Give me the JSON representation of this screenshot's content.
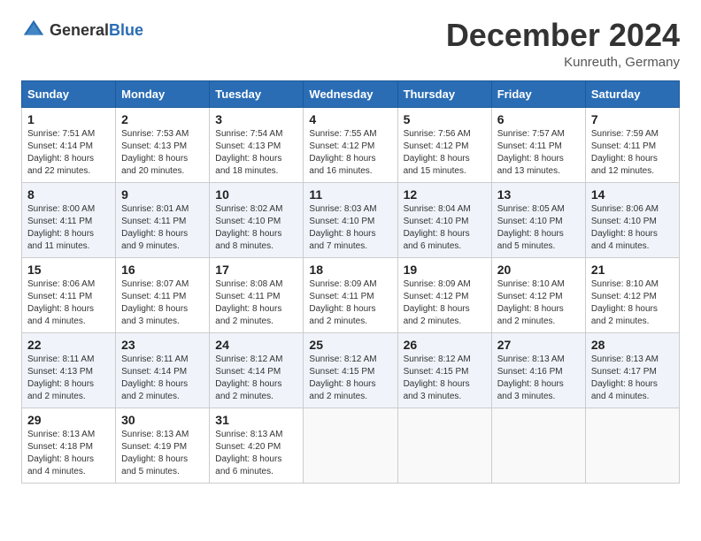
{
  "header": {
    "logo_general": "General",
    "logo_blue": "Blue",
    "month": "December 2024",
    "location": "Kunreuth, Germany"
  },
  "days_of_week": [
    "Sunday",
    "Monday",
    "Tuesday",
    "Wednesday",
    "Thursday",
    "Friday",
    "Saturday"
  ],
  "weeks": [
    [
      {
        "day": "1",
        "sunrise": "7:51 AM",
        "sunset": "4:14 PM",
        "daylight": "8 hours and 22 minutes."
      },
      {
        "day": "2",
        "sunrise": "7:53 AM",
        "sunset": "4:13 PM",
        "daylight": "8 hours and 20 minutes."
      },
      {
        "day": "3",
        "sunrise": "7:54 AM",
        "sunset": "4:13 PM",
        "daylight": "8 hours and 18 minutes."
      },
      {
        "day": "4",
        "sunrise": "7:55 AM",
        "sunset": "4:12 PM",
        "daylight": "8 hours and 16 minutes."
      },
      {
        "day": "5",
        "sunrise": "7:56 AM",
        "sunset": "4:12 PM",
        "daylight": "8 hours and 15 minutes."
      },
      {
        "day": "6",
        "sunrise": "7:57 AM",
        "sunset": "4:11 PM",
        "daylight": "8 hours and 13 minutes."
      },
      {
        "day": "7",
        "sunrise": "7:59 AM",
        "sunset": "4:11 PM",
        "daylight": "8 hours and 12 minutes."
      }
    ],
    [
      {
        "day": "8",
        "sunrise": "8:00 AM",
        "sunset": "4:11 PM",
        "daylight": "8 hours and 11 minutes."
      },
      {
        "day": "9",
        "sunrise": "8:01 AM",
        "sunset": "4:11 PM",
        "daylight": "8 hours and 9 minutes."
      },
      {
        "day": "10",
        "sunrise": "8:02 AM",
        "sunset": "4:10 PM",
        "daylight": "8 hours and 8 minutes."
      },
      {
        "day": "11",
        "sunrise": "8:03 AM",
        "sunset": "4:10 PM",
        "daylight": "8 hours and 7 minutes."
      },
      {
        "day": "12",
        "sunrise": "8:04 AM",
        "sunset": "4:10 PM",
        "daylight": "8 hours and 6 minutes."
      },
      {
        "day": "13",
        "sunrise": "8:05 AM",
        "sunset": "4:10 PM",
        "daylight": "8 hours and 5 minutes."
      },
      {
        "day": "14",
        "sunrise": "8:06 AM",
        "sunset": "4:10 PM",
        "daylight": "8 hours and 4 minutes."
      }
    ],
    [
      {
        "day": "15",
        "sunrise": "8:06 AM",
        "sunset": "4:11 PM",
        "daylight": "8 hours and 4 minutes."
      },
      {
        "day": "16",
        "sunrise": "8:07 AM",
        "sunset": "4:11 PM",
        "daylight": "8 hours and 3 minutes."
      },
      {
        "day": "17",
        "sunrise": "8:08 AM",
        "sunset": "4:11 PM",
        "daylight": "8 hours and 2 minutes."
      },
      {
        "day": "18",
        "sunrise": "8:09 AM",
        "sunset": "4:11 PM",
        "daylight": "8 hours and 2 minutes."
      },
      {
        "day": "19",
        "sunrise": "8:09 AM",
        "sunset": "4:12 PM",
        "daylight": "8 hours and 2 minutes."
      },
      {
        "day": "20",
        "sunrise": "8:10 AM",
        "sunset": "4:12 PM",
        "daylight": "8 hours and 2 minutes."
      },
      {
        "day": "21",
        "sunrise": "8:10 AM",
        "sunset": "4:12 PM",
        "daylight": "8 hours and 2 minutes."
      }
    ],
    [
      {
        "day": "22",
        "sunrise": "8:11 AM",
        "sunset": "4:13 PM",
        "daylight": "8 hours and 2 minutes."
      },
      {
        "day": "23",
        "sunrise": "8:11 AM",
        "sunset": "4:14 PM",
        "daylight": "8 hours and 2 minutes."
      },
      {
        "day": "24",
        "sunrise": "8:12 AM",
        "sunset": "4:14 PM",
        "daylight": "8 hours and 2 minutes."
      },
      {
        "day": "25",
        "sunrise": "8:12 AM",
        "sunset": "4:15 PM",
        "daylight": "8 hours and 2 minutes."
      },
      {
        "day": "26",
        "sunrise": "8:12 AM",
        "sunset": "4:15 PM",
        "daylight": "8 hours and 3 minutes."
      },
      {
        "day": "27",
        "sunrise": "8:13 AM",
        "sunset": "4:16 PM",
        "daylight": "8 hours and 3 minutes."
      },
      {
        "day": "28",
        "sunrise": "8:13 AM",
        "sunset": "4:17 PM",
        "daylight": "8 hours and 4 minutes."
      }
    ],
    [
      {
        "day": "29",
        "sunrise": "8:13 AM",
        "sunset": "4:18 PM",
        "daylight": "8 hours and 4 minutes."
      },
      {
        "day": "30",
        "sunrise": "8:13 AM",
        "sunset": "4:19 PM",
        "daylight": "8 hours and 5 minutes."
      },
      {
        "day": "31",
        "sunrise": "8:13 AM",
        "sunset": "4:20 PM",
        "daylight": "8 hours and 6 minutes."
      },
      null,
      null,
      null,
      null
    ]
  ],
  "labels": {
    "sunrise": "Sunrise: ",
    "sunset": "Sunset: ",
    "daylight": "Daylight: "
  }
}
